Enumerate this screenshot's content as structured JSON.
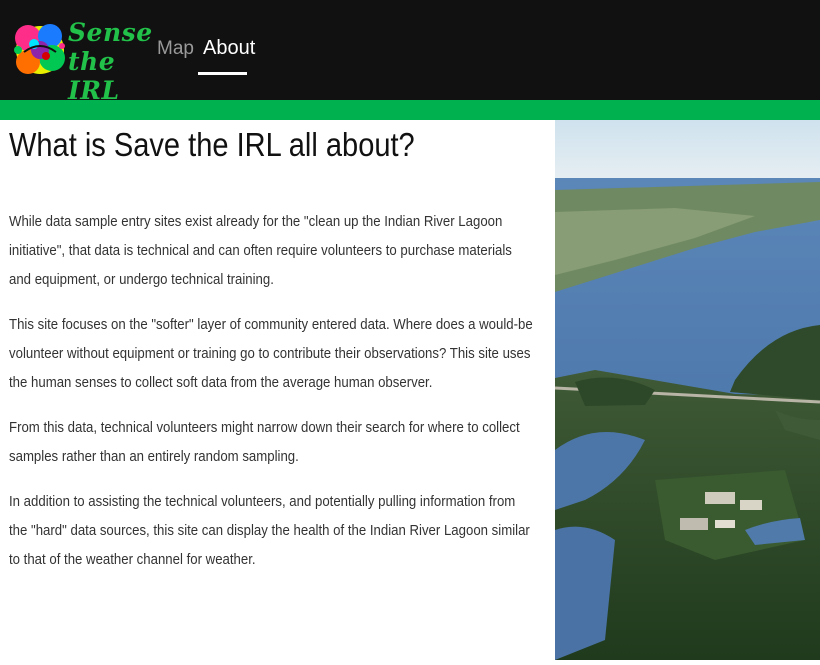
{
  "brand": {
    "logo_line1": "Sense",
    "logo_line2": "the IRL"
  },
  "nav": {
    "items": [
      {
        "label": "Map",
        "active": false
      },
      {
        "label": "About",
        "active": true
      }
    ]
  },
  "colors": {
    "navbar_bg": "#111111",
    "accent_green": "#00b14f"
  },
  "page": {
    "heading": "What is Save the IRL all about?",
    "paragraphs": [
      "While data sample entry sites exist already for the \"clean up the Indian River Lagoon initiative\", that data is technical and can often require volunteers to purchase materials and equipment, or undergo technical training.",
      "This site focuses on the \"softer\" layer of community entered data. Where does a would-be volunteer without equipment or training go to contribute their observations? This site uses the human senses to collect soft data from the average human observer.",
      "From this data, technical volunteers might narrow down their search for where to collect samples rather than an entirely random sampling.",
      "In addition to assisting the technical volunteers, and potentially pulling information from the \"hard\" data sources, this site can display the health of the Indian River Lagoon similar to that of the weather channel for weather."
    ]
  },
  "image": {
    "subject": "aerial-lagoon-photo"
  }
}
